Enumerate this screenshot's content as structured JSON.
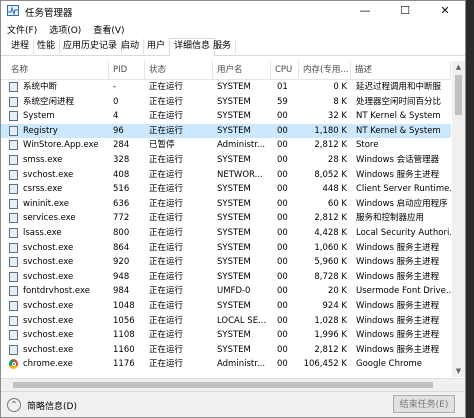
{
  "window": {
    "title": "任务管理器"
  },
  "menu": [
    "文件(F)",
    "选项(O)",
    "查看(V)"
  ],
  "tabs": [
    "进程",
    "性能",
    "应用历史记录",
    "启动",
    "用户",
    "详细信息",
    "服务"
  ],
  "active_tab": "详细信息",
  "columns": [
    "名称",
    "PID",
    "状态",
    "用户名",
    "CPU",
    "内存(专用...",
    "描述"
  ],
  "rows": [
    {
      "name": "系统中断",
      "pid": "-",
      "status": "正在运行",
      "user": "SYSTEM",
      "cpu": "01",
      "mem": "0 K",
      "desc": "延迟过程调用和中断服"
    },
    {
      "name": "系统空闲进程",
      "pid": "0",
      "status": "正在运行",
      "user": "SYSTEM",
      "cpu": "59",
      "mem": "8 K",
      "desc": "处理器空闲时间百分比"
    },
    {
      "name": "System",
      "pid": "4",
      "status": "正在运行",
      "user": "SYSTEM",
      "cpu": "00",
      "mem": "32 K",
      "desc": "NT Kernel & System"
    },
    {
      "name": "Registry",
      "pid": "96",
      "status": "正在运行",
      "user": "SYSTEM",
      "cpu": "00",
      "mem": "1,180 K",
      "desc": "NT Kernel & System",
      "selected": true
    },
    {
      "name": "WinStore.App.exe",
      "pid": "284",
      "status": "已暂停",
      "user": "Administr...",
      "cpu": "00",
      "mem": "2,812 K",
      "desc": "Store"
    },
    {
      "name": "smss.exe",
      "pid": "328",
      "status": "正在运行",
      "user": "SYSTEM",
      "cpu": "00",
      "mem": "28 K",
      "desc": "Windows 会话管理器"
    },
    {
      "name": "svchost.exe",
      "pid": "408",
      "status": "正在运行",
      "user": "NETWOR...",
      "cpu": "00",
      "mem": "8,052 K",
      "desc": "Windows 服务主进程"
    },
    {
      "name": "csrss.exe",
      "pid": "516",
      "status": "正在运行",
      "user": "SYSTEM",
      "cpu": "00",
      "mem": "448 K",
      "desc": "Client Server Runtime..."
    },
    {
      "name": "wininit.exe",
      "pid": "636",
      "status": "正在运行",
      "user": "SYSTEM",
      "cpu": "00",
      "mem": "60 K",
      "desc": "Windows 启动应用程序"
    },
    {
      "name": "services.exe",
      "pid": "772",
      "status": "正在运行",
      "user": "SYSTEM",
      "cpu": "00",
      "mem": "2,812 K",
      "desc": "服务和控制器应用"
    },
    {
      "name": "lsass.exe",
      "pid": "800",
      "status": "正在运行",
      "user": "SYSTEM",
      "cpu": "00",
      "mem": "4,428 K",
      "desc": "Local Security Authori..."
    },
    {
      "name": "svchost.exe",
      "pid": "864",
      "status": "正在运行",
      "user": "SYSTEM",
      "cpu": "00",
      "mem": "1,060 K",
      "desc": "Windows 服务主进程"
    },
    {
      "name": "svchost.exe",
      "pid": "920",
      "status": "正在运行",
      "user": "SYSTEM",
      "cpu": "00",
      "mem": "5,960 K",
      "desc": "Windows 服务主进程"
    },
    {
      "name": "svchost.exe",
      "pid": "948",
      "status": "正在运行",
      "user": "SYSTEM",
      "cpu": "00",
      "mem": "8,728 K",
      "desc": "Windows 服务主进程"
    },
    {
      "name": "fontdrvhost.exe",
      "pid": "984",
      "status": "正在运行",
      "user": "UMFD-0",
      "cpu": "00",
      "mem": "20 K",
      "desc": "Usermode Font Drive..."
    },
    {
      "name": "svchost.exe",
      "pid": "1048",
      "status": "正在运行",
      "user": "SYSTEM",
      "cpu": "00",
      "mem": "924 K",
      "desc": "Windows 服务主进程"
    },
    {
      "name": "svchost.exe",
      "pid": "1056",
      "status": "正在运行",
      "user": "LOCAL SE...",
      "cpu": "00",
      "mem": "1,028 K",
      "desc": "Windows 服务主进程"
    },
    {
      "name": "svchost.exe",
      "pid": "1108",
      "status": "正在运行",
      "user": "SYSTEM",
      "cpu": "00",
      "mem": "1,996 K",
      "desc": "Windows 服务主进程"
    },
    {
      "name": "svchost.exe",
      "pid": "1160",
      "status": "正在运行",
      "user": "SYSTEM",
      "cpu": "00",
      "mem": "2,812 K",
      "desc": "Windows 服务主进程"
    },
    {
      "name": "chrome.exe",
      "pid": "1176",
      "status": "正在运行",
      "user": "Administr...",
      "cpu": "00",
      "mem": "106,452 K",
      "desc": "Google Chrome",
      "icon": "chrome-icon"
    }
  ],
  "footer": {
    "less_details": "简略信息(D)",
    "end_task": "结束任务(E)"
  },
  "colors": {
    "selected_row": "#cce8ff",
    "header_text": "#4b4b4b"
  }
}
